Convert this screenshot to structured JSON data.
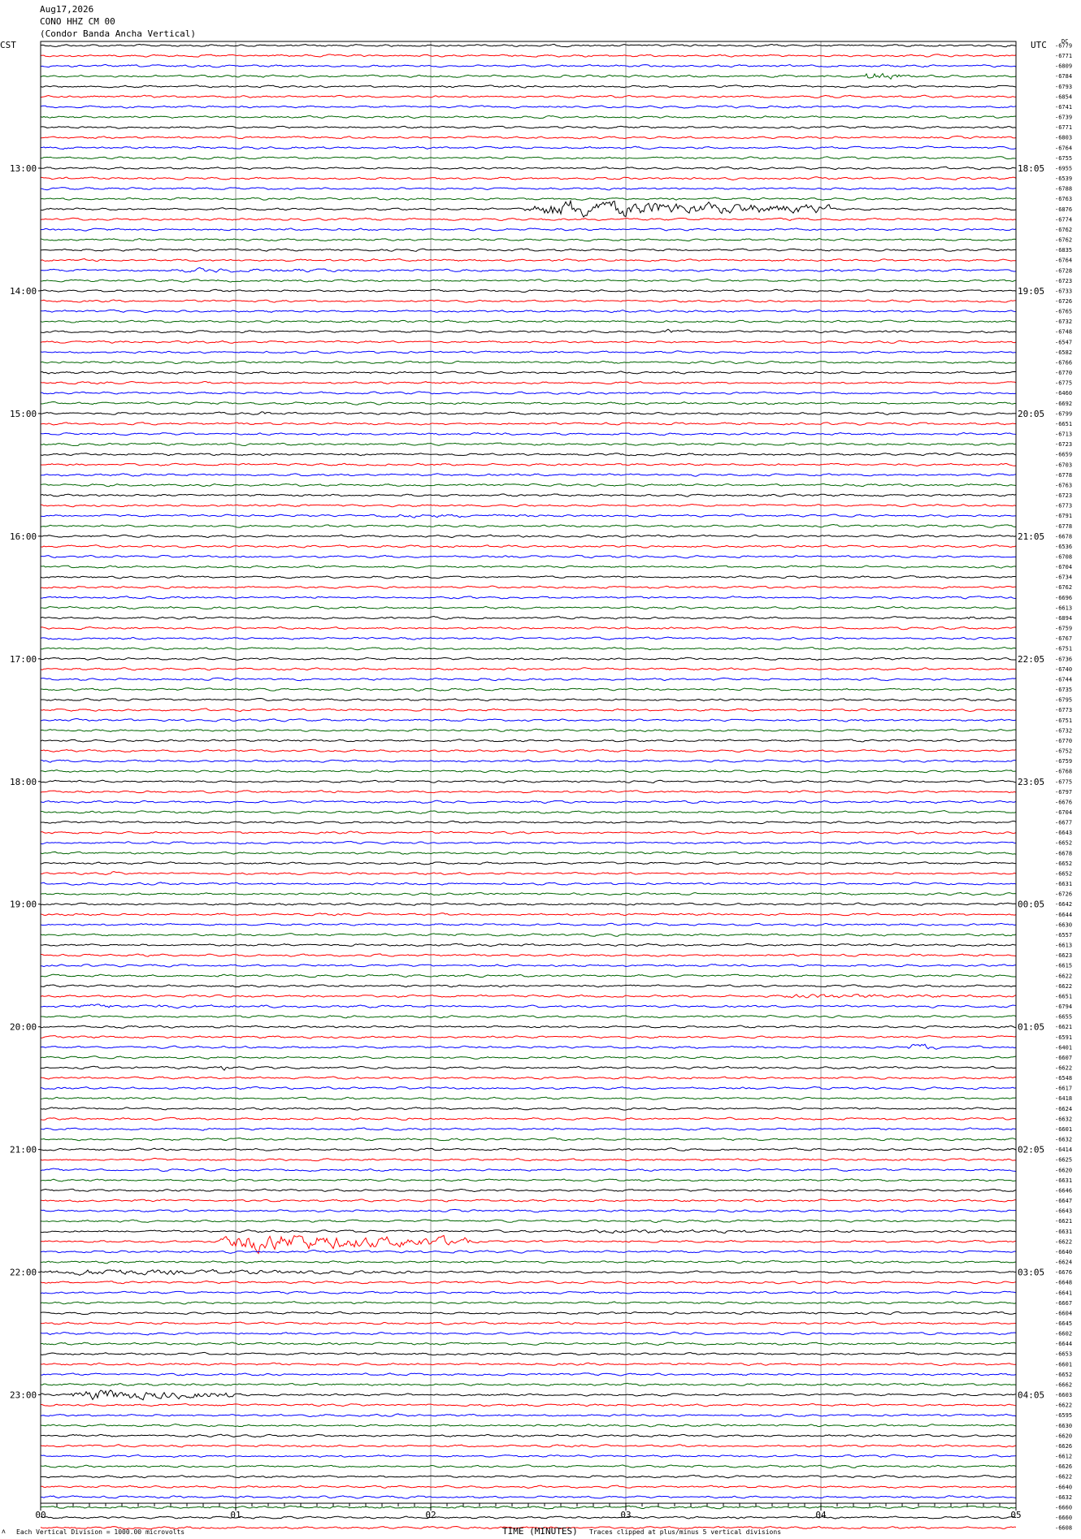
{
  "header": {
    "date": "Aug17,2026",
    "station": "CONO HHZ CM 00",
    "description": "(Condor Banda Ancha Vertical)"
  },
  "left_timezone": "CST",
  "right_timezone": "UTC",
  "right_unit": "DC",
  "footer": {
    "scale_note": "Each Vertical Division = 1000.00 microvolts",
    "xlabel": "TIME (MINUTES)",
    "clip_note": "Traces clipped at plus/minus 5 vertical divisions",
    "icon": "scale-marker-icon"
  },
  "colors": {
    "trace_cycle": [
      "#000000",
      "#ff0000",
      "#0000ff",
      "#006400"
    ],
    "grid": "#7f7f7f"
  },
  "chart_data": {
    "type": "helicorder",
    "xlabel": "TIME (MINUTES)",
    "xlim": [
      0,
      5
    ],
    "x_ticks": [
      "00",
      "01",
      "02",
      "03",
      "04",
      "05"
    ],
    "left_hour_labels": [
      "13:00",
      "14:00",
      "15:00",
      "16:00",
      "17:00",
      "18:00",
      "19:00",
      "20:00",
      "21:00",
      "22:00",
      "23:00"
    ],
    "right_hour_labels": [
      "18:05",
      "19:05",
      "20:05",
      "21:05",
      "22:05",
      "23:05",
      "00:05",
      "01:05",
      "02:05",
      "03:05",
      "04:05"
    ],
    "hour_label_rows": [
      12,
      24,
      36,
      48,
      60,
      72,
      84,
      96,
      108,
      120,
      132
    ],
    "row_offsets": [
      "-6779",
      "-6771",
      "-6809",
      "-6784",
      "-6793",
      "-6854",
      "-6741",
      "-6739",
      "-6771",
      "-6803",
      "-6764",
      "-6755",
      "-6955",
      "-6539",
      "-6788",
      "-6763",
      "-6876",
      "-6774",
      "-6762",
      "-6762",
      "-6835",
      "-6764",
      "-6728",
      "-6723",
      "-6733",
      "-6726",
      "-6765",
      "-6732",
      "-6748",
      "-6547",
      "-6582",
      "-6766",
      "-6770",
      "-6775",
      "-6460",
      "-6692",
      "-6799",
      "-6651",
      "-6713",
      "-6723",
      "-6659",
      "-6703",
      "-6778",
      "-6763",
      "-6723",
      "-6773",
      "-6791",
      "-6778",
      "-6678",
      "-6536",
      "-6708",
      "-6704",
      "-6734",
      "-6762",
      "-6696",
      "-6613",
      "-6894",
      "-6759",
      "-6767",
      "-6751",
      "-6736",
      "-6740",
      "-6744",
      "-6735",
      "-6795",
      "-6773",
      "-6751",
      "-6732",
      "-6770",
      "-6752",
      "-6759",
      "-6768",
      "-6775",
      "-6797",
      "-6676",
      "-6704",
      "-6677",
      "-6643",
      "-6652",
      "-6678",
      "-6652",
      "-6652",
      "-6631",
      "-6726",
      "-6642",
      "-6644",
      "-6630",
      "-6557",
      "-6613",
      "-6623",
      "-6615",
      "-6622",
      "-6622",
      "-6651",
      "-6794",
      "-6655",
      "-6621",
      "-6591",
      "-6401",
      "-6607",
      "-6622",
      "-6548",
      "-6617",
      "-6418",
      "-6624",
      "-6632",
      "-6601",
      "-6632",
      "-6414",
      "-6625",
      "-6620",
      "-6631",
      "-6646",
      "-6647",
      "-6643",
      "-6621",
      "-6631",
      "-6622",
      "-6640",
      "-6624",
      "-6676",
      "-6648",
      "-6641",
      "-6667",
      "-6604",
      "-6645",
      "-6602",
      "-6644",
      "-6653",
      "-6601",
      "-6652",
      "-6662",
      "-6603",
      "-6622",
      "-6595",
      "-6630",
      "-6620",
      "-6626",
      "-6612",
      "-6626",
      "-6622",
      "-6640",
      "-6632",
      "-6660",
      "-6660",
      "-6608"
    ],
    "events": [
      {
        "row": 3,
        "start_min": 4.22,
        "end_min": 4.4,
        "amp": 7,
        "label": "green"
      },
      {
        "row": 16,
        "start_min": 2.48,
        "end_min": 4.05,
        "amp": 12,
        "label": "black"
      },
      {
        "row": 22,
        "start_min": 0.6,
        "end_min": 2.1,
        "amp": 2.5,
        "label": "red"
      },
      {
        "row": 28,
        "start_min": 3.18,
        "end_min": 3.35,
        "amp": 3.5,
        "label": "green"
      },
      {
        "row": 28,
        "start_min": 4.3,
        "end_min": 4.6,
        "amp": 2.5,
        "label": "green"
      },
      {
        "row": 36,
        "start_min": 1.1,
        "end_min": 1.2,
        "amp": 3,
        "label": "green"
      },
      {
        "row": 46,
        "start_min": 1.5,
        "end_min": 3.6,
        "amp": 2,
        "label": "blue"
      },
      {
        "row": 56,
        "start_min": 4.7,
        "end_min": 5.0,
        "amp": 2.5,
        "label": "green"
      },
      {
        "row": 81,
        "start_min": 0.35,
        "end_min": 0.45,
        "amp": 2.5,
        "label": "red"
      },
      {
        "row": 93,
        "start_min": 3.75,
        "end_min": 5.0,
        "amp": 3,
        "label": "black"
      },
      {
        "row": 94,
        "start_min": 0.0,
        "end_min": 1.6,
        "amp": 2.5,
        "label": "red"
      },
      {
        "row": 98,
        "start_min": 4.45,
        "end_min": 4.6,
        "amp": 6,
        "label": "blue"
      },
      {
        "row": 100,
        "start_min": 0.92,
        "end_min": 1.0,
        "amp": 4,
        "label": "black"
      },
      {
        "row": 116,
        "start_min": 2.6,
        "end_min": 5.0,
        "amp": 2.5,
        "label": "black"
      },
      {
        "row": 117,
        "start_min": 0.92,
        "end_min": 2.2,
        "amp": 12,
        "label": "red"
      },
      {
        "row": 120,
        "start_min": 0.0,
        "end_min": 1.9,
        "amp": 4,
        "label": "black"
      },
      {
        "row": 132,
        "start_min": 0.15,
        "end_min": 1.0,
        "amp": 8,
        "label": "black"
      }
    ]
  }
}
